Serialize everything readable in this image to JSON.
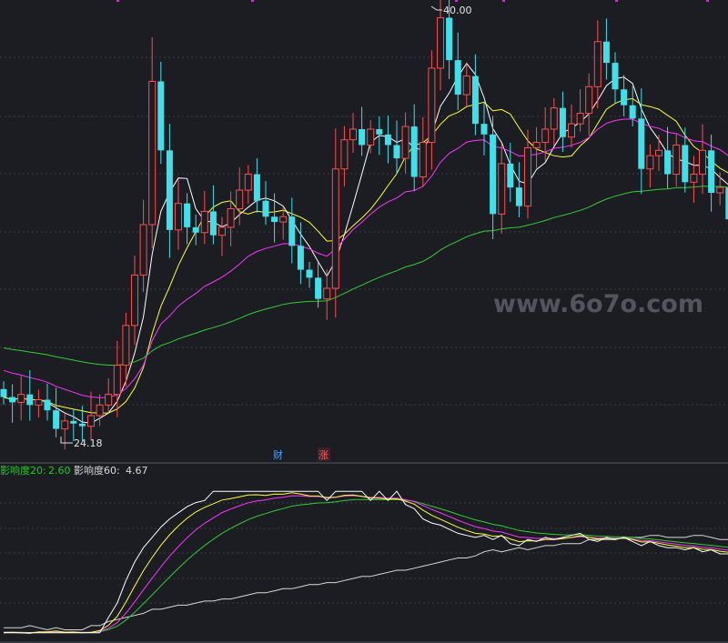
{
  "main_panel": {
    "high_label": "40.00",
    "low_label": "24.18",
    "badges": [
      {
        "text": "财",
        "color": "#4aa3ff"
      },
      {
        "text": "涨",
        "color": "#ff5a5a"
      }
    ],
    "watermark": "www.6o7o.com"
  },
  "indicator_panel": {
    "label_20": "影响度20:",
    "value_20": "2.60",
    "label_60": "影响度60:",
    "value_60": "4.67",
    "color_20": "#19d219",
    "color_60": "#d9d9d9"
  },
  "colors": {
    "up": "#ff4d4d",
    "down": "#3fe0ea",
    "ma5": "#ffffff",
    "ma10": "#ffff33",
    "ma20": "#ff33ff",
    "ma60": "#33cc33",
    "background": "#1b1d22",
    "grid": "#3a3d45"
  },
  "chart_data": [
    {
      "type": "candlestick",
      "series": [
        {
          "name": "",
          "closes": [
            25.5,
            25.3,
            25.6,
            25.2,
            25.4,
            25.0,
            24.3,
            24.6,
            24.5,
            24.4,
            24.8,
            25.2,
            25.6,
            26.7,
            28.2,
            30.1,
            32.0,
            37.4,
            34.8,
            31.8,
            32.8,
            31.9,
            31.7,
            32.5,
            31.6,
            31.9,
            32.6,
            33.3,
            33.9,
            32.9,
            32.3,
            32.1,
            32.3,
            31.2,
            30.3,
            30.0,
            29.2,
            29.6,
            34.1,
            35.2,
            35.6,
            35.0,
            35.6,
            35.4,
            35.0,
            34.5,
            35.7,
            33.8,
            35.1,
            37.9,
            39.8,
            38.2,
            36.9,
            37.6,
            35.8,
            35.4,
            32.4,
            34.3,
            33.4,
            32.7,
            34.9,
            35.1,
            35.6,
            36.4,
            35.3,
            35.8,
            36.2,
            37.2,
            38.9,
            38.1,
            37.1,
            36.5,
            36.0,
            34.1,
            34.6,
            34.8,
            33.9,
            35.0,
            33.6,
            33.9,
            34.8,
            33.2,
            33.4,
            32.2
          ]
        }
      ]
    },
    {
      "type": "line",
      "series": [
        {
          "name": "影响度20",
          "values": [
            24.0,
            24.1,
            24.0,
            24.0,
            24.2,
            24.1,
            24.2,
            24.0,
            24.1,
            24.0,
            24.1,
            24.3,
            24.8,
            25.5,
            26.6,
            27.5,
            28.2,
            28.7,
            29.2,
            29.6,
            29.9,
            30.2,
            30.4,
            30.5,
            30.6,
            30.8,
            30.7,
            30.8,
            30.9,
            30.8,
            30.7,
            30.9,
            30.8,
            31.0,
            30.7,
            30.6,
            30.7,
            30.5,
            30.7,
            30.9,
            30.8,
            30.6,
            30.5,
            30.6,
            30.5,
            30.6,
            30.3,
            30.1,
            29.6,
            29.4,
            29.3,
            29.1,
            28.9,
            28.8,
            28.7,
            28.8,
            28.6,
            28.8,
            28.4,
            28.3,
            28.6,
            28.5,
            28.7,
            28.6,
            28.7,
            28.8,
            28.9,
            28.6,
            28.5,
            28.7,
            28.6,
            28.7,
            28.5,
            28.3,
            28.5,
            28.3,
            28.2,
            28.2,
            28.1,
            28.2,
            28.0,
            28.1,
            27.9,
            27.9
          ]
        },
        {
          "name": "影响度60",
          "values": [
            24.3,
            24.3,
            24.3,
            24.4,
            24.3,
            24.2,
            24.3,
            24.2,
            24.2,
            24.2,
            24.4,
            24.4,
            24.6,
            24.7,
            24.8,
            24.9,
            25.0,
            25.2,
            25.2,
            25.3,
            25.4,
            25.4,
            25.5,
            25.6,
            25.6,
            25.7,
            25.7,
            25.8,
            25.9,
            26.0,
            26.0,
            26.1,
            26.2,
            26.2,
            26.3,
            26.4,
            26.4,
            26.5,
            26.5,
            26.6,
            26.7,
            26.8,
            26.8,
            26.9,
            27.0,
            27.1,
            27.1,
            27.2,
            27.3,
            27.4,
            27.5,
            27.6,
            27.7,
            27.7,
            27.8,
            28.0,
            28.1,
            28.0,
            28.1,
            28.2,
            28.1,
            28.2,
            28.3,
            28.3,
            28.4,
            28.4,
            28.4,
            28.6,
            28.6,
            28.6,
            28.6,
            28.7,
            28.7,
            28.7,
            28.8,
            28.8,
            28.7,
            28.7,
            28.7,
            28.8,
            28.8,
            28.7,
            28.6,
            28.6
          ]
        }
      ]
    }
  ]
}
